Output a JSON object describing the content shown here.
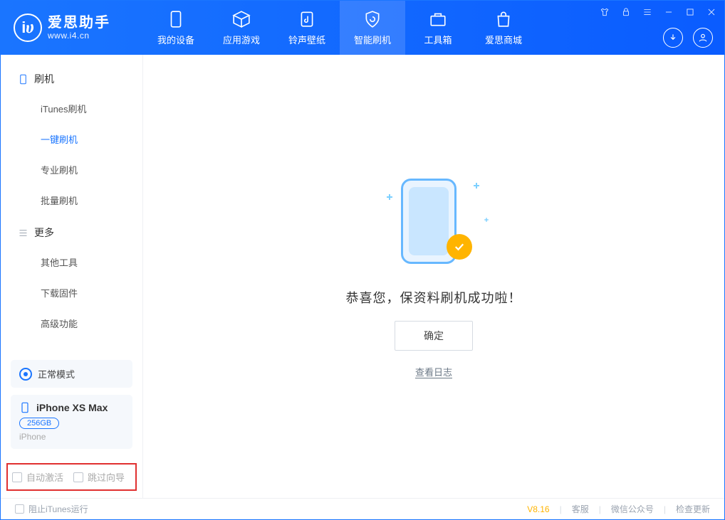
{
  "app": {
    "title": "爱思助手",
    "subtitle": "www.i4.cn"
  },
  "tabs": [
    {
      "id": "device",
      "label": "我的设备"
    },
    {
      "id": "apps",
      "label": "应用游戏"
    },
    {
      "id": "ring",
      "label": "铃声壁纸"
    },
    {
      "id": "flash",
      "label": "智能刷机"
    },
    {
      "id": "toolbox",
      "label": "工具箱"
    },
    {
      "id": "mall",
      "label": "爱思商城"
    }
  ],
  "sidebar": {
    "groups": [
      {
        "title": "刷机",
        "items": [
          "iTunes刷机",
          "一键刷机",
          "专业刷机",
          "批量刷机"
        ],
        "active_index": 1
      },
      {
        "title": "更多",
        "items": [
          "其他工具",
          "下载固件",
          "高级功能"
        ],
        "active_index": -1
      }
    ],
    "mode_label": "正常模式",
    "device": {
      "name": "iPhone XS Max",
      "storage": "256GB",
      "type": "iPhone"
    },
    "options": {
      "auto_activate": "自动激活",
      "skip_guide": "跳过向导"
    }
  },
  "main": {
    "success_text": "恭喜您，保资料刷机成功啦！",
    "ok_button": "确定",
    "log_link": "查看日志"
  },
  "footer": {
    "block_itunes": "阻止iTunes运行",
    "version": "V8.16",
    "links": [
      "客服",
      "微信公众号",
      "检查更新"
    ]
  }
}
